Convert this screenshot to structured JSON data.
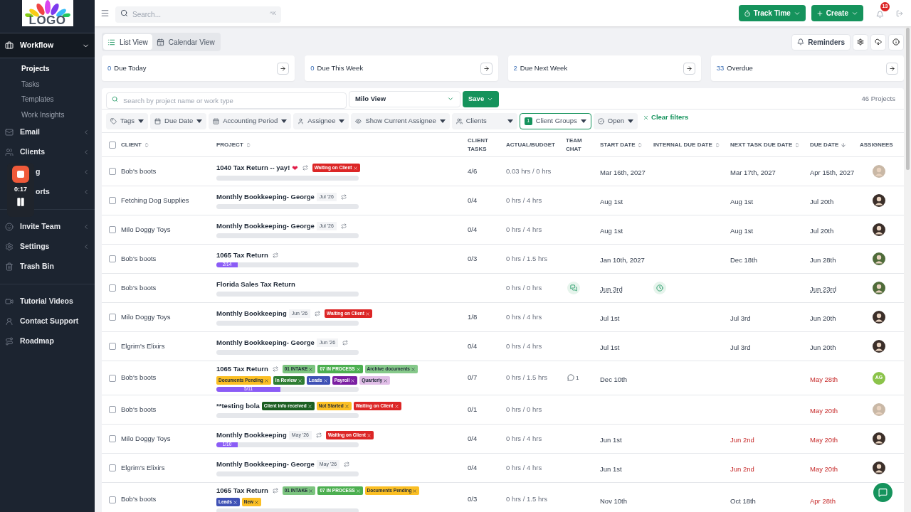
{
  "sidebar": {
    "logo_text": "LOGO",
    "groups": [
      {
        "items": [
          {
            "label": "Workflow",
            "selected": true,
            "expanded": true,
            "children": [
              {
                "label": "Projects",
                "selected": true
              },
              {
                "label": "Tasks",
                "selected": false
              },
              {
                "label": "Templates",
                "selected": false
              },
              {
                "label": "Work Insights",
                "selected": false
              }
            ]
          },
          {
            "label": "Email",
            "selected": false,
            "expanded": false
          },
          {
            "label": "Clients",
            "selected": false,
            "expanded": false
          },
          {
            "label": "g",
            "selected": false,
            "expanded": false,
            "covered": true
          },
          {
            "label": "orts",
            "selected": false,
            "expanded": false,
            "covered": true
          }
        ]
      },
      {
        "items": [
          {
            "label": "Invite Team",
            "selected": false,
            "expanded": false
          },
          {
            "label": "Settings",
            "selected": false,
            "expanded": false
          },
          {
            "label": "Trash Bin",
            "selected": false
          }
        ]
      },
      {
        "items": [
          {
            "label": "Tutorial Videos",
            "selected": false
          },
          {
            "label": "Contact Support",
            "selected": false
          },
          {
            "label": "Roadmap",
            "selected": false
          }
        ]
      }
    ]
  },
  "recorder": {
    "time": "0:17"
  },
  "topbar": {
    "search_placeholder": "Search...",
    "shortcut": "^K",
    "track_time": "Track Time",
    "create": "Create",
    "notifications": "13"
  },
  "views": [
    {
      "label": "List View",
      "selected": true
    },
    {
      "label": "Calendar View",
      "selected": false
    }
  ],
  "reminders": "Reminders",
  "summary": [
    {
      "count": "0",
      "label": "Due Today"
    },
    {
      "count": "0",
      "label": "Due This Week"
    },
    {
      "count": "2",
      "label": "Due Next Week"
    },
    {
      "count": "33",
      "label": "Overdue"
    }
  ],
  "project_search": {
    "placeholder": "Search by project name or work type",
    "view": "Milo View",
    "save": "Save",
    "total": "46 Projects"
  },
  "filters": [
    {
      "label": "Tags",
      "active": false
    },
    {
      "label": "Due Date",
      "active": false
    },
    {
      "label": "Accounting Period",
      "active": false
    },
    {
      "label": "Assignee",
      "active": false
    },
    {
      "label": "Show Current Assignee",
      "active": false
    },
    {
      "label": "Clients",
      "active": false
    },
    {
      "label": "Client Groups",
      "active": true,
      "count": "1"
    },
    {
      "label": "Open",
      "active": false
    }
  ],
  "clear_filters": "Clear filters",
  "select_all_checked": false,
  "columns": [
    {
      "label": "CLIENT",
      "sortable": true,
      "sorted_desc": false
    },
    {
      "label": "PROJECT",
      "sortable": true,
      "sorted_desc": false
    },
    {
      "label": "CLIENT TASKS",
      "sortable": false
    },
    {
      "label": "ACTUAL/BUDGET",
      "sortable": false
    },
    {
      "label": "TEAM CHAT",
      "sortable": false
    },
    {
      "label": "START DATE",
      "sortable": true,
      "sorted_desc": false
    },
    {
      "label": "INTERNAL DUE DATE",
      "sortable": true,
      "sorted_desc": false
    },
    {
      "label": "NEXT TASK DUE DATE",
      "sortable": true,
      "sorted_desc": false
    },
    {
      "label": "DUE DATE",
      "sortable": true,
      "sorted_desc": true
    },
    {
      "label": "ASSIGNEES",
      "sortable": false
    }
  ],
  "rows": [
    {
      "checked": false,
      "client": "Bob's boots",
      "project": {
        "title": "1040 Tax Return -- yay!",
        "emoji": "❤",
        "recurring": true,
        "tags": [
          {
            "label": "Waiting on Client",
            "color": "#dc2626"
          }
        ]
      },
      "client_tasks": "4/6",
      "hours": "0.03 hrs / 0 hrs",
      "start": {
        "text": "Mar 16th, 2027"
      },
      "next_task": {
        "text": "Mar 17th, 2027",
        "overdue": false
      },
      "due": {
        "text": "Apr 15th, 2027",
        "overdue": false
      },
      "assignee": {
        "kind": "photo",
        "color": "#c9b8a6"
      }
    },
    {
      "checked": false,
      "client": "Fetching Dog Supplies",
      "project": {
        "title": "Monthly Bookkeeping- George",
        "period": "Jul '26",
        "recurring": true
      },
      "client_tasks": "0/4",
      "hours": "0 hrs / 4 hrs",
      "start": {
        "text": "Aug 1st"
      },
      "next_task": {
        "text": "Aug 1st",
        "overdue": false
      },
      "due": {
        "text": "Jul 20th",
        "overdue": false
      },
      "assignee": {
        "kind": "photo",
        "color": "#3b2f2a"
      }
    },
    {
      "checked": false,
      "client": "Milo Doggy Toys",
      "project": {
        "title": "Monthly Bookkeeping- George",
        "period": "Jul '26",
        "recurring": true
      },
      "client_tasks": "0/4",
      "hours": "0 hrs / 4 hrs",
      "start": {
        "text": "Aug 1st"
      },
      "next_task": {
        "text": "Aug 1st",
        "overdue": false
      },
      "due": {
        "text": "Jul 20th",
        "overdue": false
      },
      "assignee": {
        "kind": "photo",
        "color": "#3b2f2a"
      }
    },
    {
      "checked": false,
      "client": "Bob's boots",
      "project": {
        "title": "1065 Tax Return",
        "recurring": true,
        "progress": {
          "level": 0.15,
          "label": "2/14"
        }
      },
      "client_tasks": "0/3",
      "hours": "0 hrs / 1.5 hrs",
      "start": {
        "text": "Jan 10th, 2027"
      },
      "next_task": {
        "text": "Dec 18th",
        "overdue": false
      },
      "due": {
        "text": "Jun 28th",
        "overdue": false
      },
      "assignee": {
        "kind": "photo",
        "color": "#4f6b3a"
      }
    },
    {
      "checked": false,
      "client": "Bob's boots",
      "project": {
        "title": "Florida Sales Tax Return",
        "recurring": false
      },
      "hours": "0 hrs / 0 hrs",
      "chat": {
        "kind": "icon"
      },
      "start": {
        "text": "Jun 3rd",
        "dotted": true
      },
      "internal_due": {
        "kind": "clock"
      },
      "due": {
        "text": "Jun 23rd",
        "overdue": false,
        "dotted": true
      },
      "assignee": {
        "kind": "photo",
        "color": "#4f6b3a"
      }
    },
    {
      "checked": false,
      "client": "Milo Doggy Toys",
      "project": {
        "title": "Monthly Bookkeeping",
        "period": "Jun '26",
        "recurring": true,
        "tags": [
          {
            "label": "Waiting on Client",
            "color": "#dc2626"
          }
        ]
      },
      "client_tasks": "1/8",
      "hours": "0 hrs / 4 hrs",
      "start": {
        "text": "Jul 1st"
      },
      "next_task": {
        "text": "Jul 3rd",
        "overdue": false
      },
      "due": {
        "text": "Jun 20th",
        "overdue": false
      },
      "assignee": {
        "kind": "photo",
        "color": "#3b2f2a"
      }
    },
    {
      "checked": false,
      "client": "Elgrim's Elixirs",
      "project": {
        "title": "Monthly Bookkeeping- George",
        "period": "Jun '26",
        "recurring": true
      },
      "client_tasks": "0/4",
      "hours": "0 hrs / 4 hrs",
      "start": {
        "text": "Jul 1st"
      },
      "next_task": {
        "text": "Jul 3rd",
        "overdue": false
      },
      "due": {
        "text": "Jun 20th",
        "overdue": false
      },
      "assignee": {
        "kind": "photo",
        "color": "#3b2f2a"
      }
    },
    {
      "checked": false,
      "client": "Bob's boots",
      "project": {
        "title": "1065 Tax Return",
        "recurring": true,
        "tags": [
          {
            "label": "01 INTAKE",
            "color": "#7cc47f"
          },
          {
            "label": "07 IN PROCESS",
            "color": "#4caf50"
          },
          {
            "label": "Archive documents",
            "color": "#86c98a"
          },
          {
            "label": "Documents Pending",
            "color": "#fbbf24"
          },
          {
            "label": "In Review",
            "color": "#2e7d32"
          },
          {
            "label": "Leads",
            "color": "#3f51b5"
          },
          {
            "label": "Payroll",
            "color": "#7b1fa2"
          },
          {
            "label": "Quarterly",
            "color": "#e1bee7"
          }
        ],
        "progress": {
          "level": 0.45,
          "label": "5/11"
        }
      },
      "client_tasks": "0/7",
      "hours": "0 hrs / 1.5 hrs",
      "chat": {
        "kind": "count",
        "count": "1"
      },
      "start": {
        "text": "Dec 10th"
      },
      "due": {
        "text": "May 28th",
        "overdue": true
      },
      "assignee": {
        "kind": "initials",
        "initials": "AG",
        "color": "#8bc34a"
      }
    },
    {
      "checked": false,
      "client": "Bob's boots",
      "project": {
        "title": "**testing bola",
        "recurring": false,
        "tags": [
          {
            "label": "Client info received",
            "color": "#1b5e20"
          },
          {
            "label": "Not Started",
            "color": "#fbbf24"
          },
          {
            "label": "Waiting on Client",
            "color": "#dc2626"
          }
        ]
      },
      "client_tasks": "0/1",
      "hours": "0 hrs / 0 hrs",
      "due": {
        "text": "May 20th",
        "overdue": true
      },
      "assignee": {
        "kind": "photo",
        "color": "#c9b8a6"
      }
    },
    {
      "checked": false,
      "client": "Milo Doggy Toys",
      "project": {
        "title": "Monthly Bookkeeping",
        "period": "May '26",
        "recurring": true,
        "tags": [
          {
            "label": "Waiting on Client",
            "color": "#dc2626"
          }
        ],
        "progress": {
          "level": 0.15,
          "label": "1/10"
        }
      },
      "client_tasks": "0/4",
      "hours": "0 hrs / 4 hrs",
      "start": {
        "text": "Jun 1st"
      },
      "next_task": {
        "text": "Jun 2nd",
        "overdue": true
      },
      "due": {
        "text": "May 20th",
        "overdue": true
      },
      "assignee": {
        "kind": "photo",
        "color": "#3b2f2a"
      }
    },
    {
      "checked": false,
      "client": "Elgrim's Elixirs",
      "project": {
        "title": "Monthly Bookkeeping- George",
        "period": "May '26",
        "recurring": true
      },
      "client_tasks": "0/4",
      "hours": "0 hrs / 4 hrs",
      "start": {
        "text": "Jun 1st"
      },
      "next_task": {
        "text": "Jun 2nd",
        "overdue": true
      },
      "due": {
        "text": "May 20th",
        "overdue": true
      },
      "assignee": {
        "kind": "photo",
        "color": "#3b2f2a"
      }
    },
    {
      "checked": false,
      "client": "Bob's boots",
      "project": {
        "title": "1065 Tax Return",
        "recurring": true,
        "tags": [
          {
            "label": "01 INTAKE",
            "color": "#7cc47f"
          },
          {
            "label": "07 IN PROCESS",
            "color": "#4caf50"
          },
          {
            "label": "Documents Pending",
            "color": "#fbbf24"
          },
          {
            "label": "Leads",
            "color": "#3f51b5"
          },
          {
            "label": "New",
            "color": "#fbbf24"
          }
        ]
      },
      "client_tasks": "0/3",
      "hours": "0 hrs / 1.5 hrs",
      "start": {
        "text": "Nov 10th"
      },
      "next_task": {
        "text": "Oct 18th",
        "overdue": false
      },
      "due": {
        "text": "Apr 28th",
        "overdue": true
      }
    }
  ]
}
